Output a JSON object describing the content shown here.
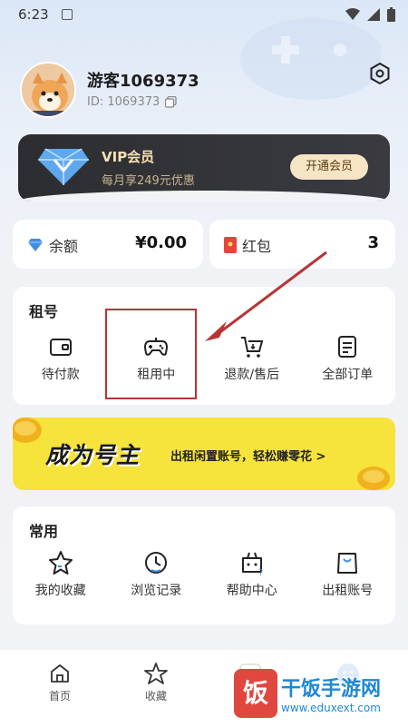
{
  "status_bar": {
    "time": "6:23"
  },
  "profile": {
    "username": "游客1069373",
    "id_text": "ID: 1069373"
  },
  "vip": {
    "title": "VIP会员",
    "subtitle": "每月享249元优惠",
    "button": "开通会员"
  },
  "balance": {
    "label": "余额",
    "value": "¥0.00"
  },
  "redpack": {
    "label": "红包",
    "value": "3"
  },
  "rent_section": {
    "title": "租号",
    "items": [
      {
        "label": "待付款",
        "icon": "wallet-icon"
      },
      {
        "label": "租用中",
        "icon": "gamepad-icon"
      },
      {
        "label": "退款/售后",
        "icon": "cart-refund-icon"
      },
      {
        "label": "全部订单",
        "icon": "order-list-icon"
      }
    ]
  },
  "banner": {
    "logo": "成为号主",
    "text": "出租闲置账号，轻松赚零花 >"
  },
  "common_section": {
    "title": "常用",
    "items": [
      {
        "label": "我的收藏",
        "icon": "star-icon"
      },
      {
        "label": "浏览记录",
        "icon": "history-icon"
      },
      {
        "label": "帮助中心",
        "icon": "help-icon"
      },
      {
        "label": "出租账号",
        "icon": "bag-icon"
      }
    ]
  },
  "tabbar": {
    "items": [
      {
        "label": "首页",
        "icon": "home-icon"
      },
      {
        "label": "收藏",
        "icon": "star-outline-icon"
      },
      {
        "label": "",
        "icon": "message-icon"
      },
      {
        "label": "",
        "icon": "profile-icon"
      }
    ]
  },
  "watermark": {
    "text": "干饭手游网",
    "url": "www.eduxext.com",
    "logo": "饭"
  },
  "colors": {
    "vip_dark": "#2c2d31",
    "vip_gold": "#f6e0b4",
    "banner_yellow": "#f6e33c",
    "highlight_red": "#b63535",
    "accent_blue": "#1e88d6"
  }
}
